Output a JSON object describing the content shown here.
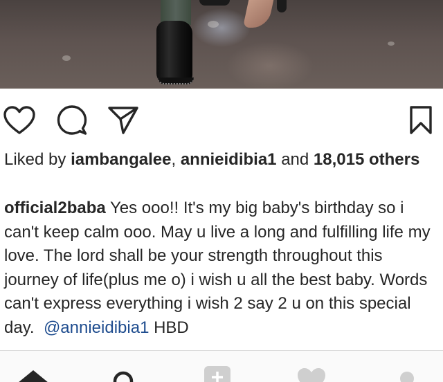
{
  "post": {
    "likes": {
      "prefix": "Liked by",
      "user1": "iambangalee",
      "separator": ",",
      "user2": "annieidibia1",
      "and_text": "and",
      "count": "18,015",
      "others_label": "others"
    },
    "caption": {
      "username": "official2baba",
      "text": "Yes ooo!! It's my big baby's birthday so i can't keep calm ooo. May u live a long and fulfilling life my love. The lord shall be your strength throughout this journey of life(plus me o) i wish u all the best baby.  Words can't express everything i wish 2 say 2 u on this special day.",
      "mention": "@annieidibia1",
      "suffix": "HBD"
    }
  },
  "actions": {
    "like_icon": "heart-outline-icon",
    "comment_icon": "comment-bubble-icon",
    "share_icon": "paper-plane-icon",
    "save_icon": "bookmark-icon"
  },
  "tabs": {
    "icons": [
      "home-icon",
      "search-icon",
      "add-post-icon",
      "activity-heart-icon",
      "profile-icon"
    ]
  },
  "colors": {
    "text": "#262626",
    "mention": "#1f4d8f",
    "tabbar_bg": "#fafafa",
    "divider": "#dbdbdb"
  }
}
